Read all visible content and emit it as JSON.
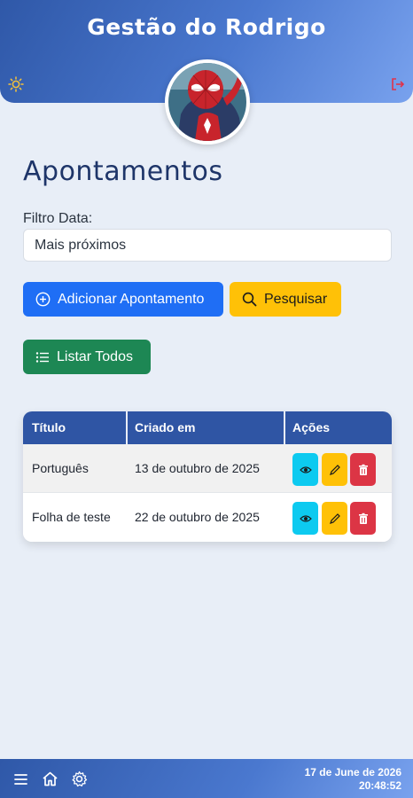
{
  "header": {
    "title": "Gestão do Rodrigo",
    "theme_icon": "sun-icon",
    "logout_icon": "logout-icon",
    "avatar": "user-avatar"
  },
  "main": {
    "title": "Apontamentos",
    "filter": {
      "label": "Filtro Data:",
      "selected": "Mais próximos"
    },
    "buttons": {
      "add": "Adicionar Apontamento",
      "search": "Pesquisar",
      "list_all": "Listar Todos"
    }
  },
  "table": {
    "headers": {
      "title": "Título",
      "created": "Criado em",
      "actions": "Ações"
    },
    "rows": [
      {
        "title": "Português",
        "created": "13 de outubro de 2025"
      },
      {
        "title": "Folha de teste",
        "created": "22 de outubro de 2025"
      }
    ],
    "action_icons": [
      "eye-icon",
      "pencil-icon",
      "trash-icon"
    ]
  },
  "footer": {
    "icons": [
      "menu-icon",
      "home-icon",
      "gear-icon"
    ],
    "date": "17 de June de 2026",
    "time": "20:48:52"
  },
  "colors": {
    "primary": "#1f6ef5",
    "warning": "#ffc107",
    "success": "#1d8754",
    "info": "#0dcaf0",
    "danger": "#dc3545",
    "header": "#2f55a4"
  }
}
